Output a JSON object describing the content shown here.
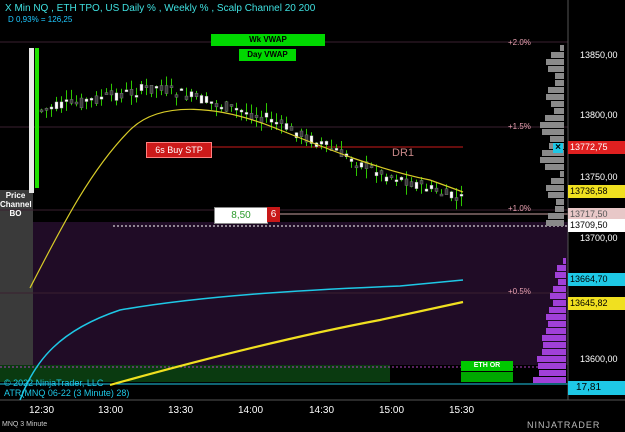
{
  "header": {
    "title": "X Min NQ , ETH TPO, US Daily % , Weekly % , Scalp Channel 20  200",
    "subtitle": "D 0,93% = 126,25"
  },
  "vwap": {
    "weekly": "Wk VWAP",
    "daily": "Day VWAP"
  },
  "percent_labels": [
    "+2.0%",
    "+1.5%",
    "+1.0%",
    "+0.5%"
  ],
  "dr1": "DR1",
  "buy_stop": {
    "label": "6s  Buy STP"
  },
  "order_box": {
    "price": "8,50",
    "qty": "6"
  },
  "price_channel": "Price\nChannel\nBO",
  "eth_or": "ETH OR",
  "copyright": "© 2022 NinjaTrader, LLC",
  "atr_label": "ATR(MNQ 06-22 (3 Minute) 28)",
  "atr_value": "17,81",
  "instrument": "MNQ 3 Minute",
  "brand": "NINJATRADER",
  "price_axis": [
    "13850,00",
    "13800,00",
    "13750,00",
    "13700,00",
    "13600,00"
  ],
  "price_flags": {
    "stop": "13772,75",
    "yellow_ma": "13736,58",
    "last": "13717,50",
    "white_line": "13709,50",
    "cyan": "13664,70",
    "yellow_low": "13645,82"
  },
  "time_axis": [
    "12:30",
    "13:00",
    "13:30",
    "14:00",
    "14:30",
    "15:00",
    "15:30"
  ],
  "colors": {
    "up": "#ffffff",
    "down": "#3b3b3b",
    "wick": "#2dc800",
    "vwap_green": "#00d800",
    "cyan": "#1ec8e6",
    "yellow": "#f0e020",
    "stop_red": "#cc1a1a"
  }
}
